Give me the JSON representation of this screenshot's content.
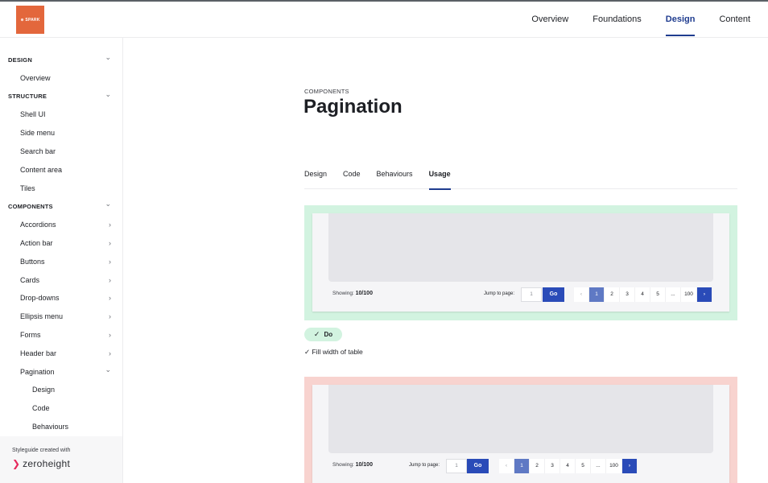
{
  "brand": {
    "logo_text": "⊕ SPARK",
    "logo_color": "#e3673c"
  },
  "topnav": [
    {
      "label": "Overview",
      "active": false
    },
    {
      "label": "Foundations",
      "active": false
    },
    {
      "label": "Design",
      "active": true
    },
    {
      "label": "Content",
      "active": false
    }
  ],
  "sidebar": {
    "items": [
      {
        "label": "DESIGN",
        "level": "section",
        "chevron": "chevron-down"
      },
      {
        "label": "Overview",
        "level": "l1",
        "chevron": ""
      },
      {
        "label": "STRUCTURE",
        "level": "section",
        "chevron": "chevron-down"
      },
      {
        "label": "Shell UI",
        "level": "l1",
        "chevron": ""
      },
      {
        "label": "Side menu",
        "level": "l1",
        "chevron": ""
      },
      {
        "label": "Search bar",
        "level": "l1",
        "chevron": ""
      },
      {
        "label": "Content area",
        "level": "l1",
        "chevron": ""
      },
      {
        "label": "Tiles",
        "level": "l1",
        "chevron": ""
      },
      {
        "label": "COMPONENTS",
        "level": "section",
        "chevron": "chevron-down"
      },
      {
        "label": "Accordions",
        "level": "l1",
        "chevron": "chevron-right"
      },
      {
        "label": "Action bar",
        "level": "l1",
        "chevron": "chevron-right"
      },
      {
        "label": "Buttons",
        "level": "l1",
        "chevron": "chevron-right"
      },
      {
        "label": "Cards",
        "level": "l1",
        "chevron": "chevron-right"
      },
      {
        "label": "Drop-downs",
        "level": "l1",
        "chevron": "chevron-right"
      },
      {
        "label": "Ellipsis menu",
        "level": "l1",
        "chevron": "chevron-right"
      },
      {
        "label": "Forms",
        "level": "l1",
        "chevron": "chevron-right"
      },
      {
        "label": "Header bar",
        "level": "l1",
        "chevron": "chevron-right"
      },
      {
        "label": "Pagination",
        "level": "l1",
        "chevron": "chevron-down"
      },
      {
        "label": "Design",
        "level": "l2",
        "chevron": ""
      },
      {
        "label": "Code",
        "level": "l2",
        "chevron": ""
      },
      {
        "label": "Behaviours",
        "level": "l2",
        "chevron": ""
      }
    ],
    "footer": {
      "made_with": "Styleguide created with",
      "brand": "zeroheight"
    }
  },
  "main": {
    "eyebrow": "COMPONENTS",
    "title": "Pagination",
    "tabs": [
      {
        "label": "Design",
        "active": false
      },
      {
        "label": "Code",
        "active": false
      },
      {
        "label": "Behaviours",
        "active": false
      },
      {
        "label": "Usage",
        "active": true
      }
    ],
    "examples": [
      {
        "kind": "do",
        "showing_label": "Showing:",
        "showing_value": "10/100",
        "jump_label": "Jump to page:",
        "input_value": "1",
        "go_label": "Go",
        "pages": [
          "‹",
          "1",
          "2",
          "3",
          "4",
          "5",
          "...",
          "100",
          "›"
        ],
        "current_page": "1"
      },
      {
        "kind": "dont",
        "showing_label": "Showing:",
        "showing_value": "10/100",
        "jump_label": "Jump to page:",
        "input_value": "1",
        "go_label": "Go",
        "pages": [
          "‹",
          "1",
          "2",
          "3",
          "4",
          "5",
          "...",
          "100",
          "›"
        ],
        "current_page": "1"
      }
    ],
    "badge": {
      "icon": "✓",
      "label": "Do"
    },
    "guidance": "✓ Fill width of table"
  },
  "colors": {
    "accent": "#1f3c8f",
    "button": "#2a4bb8",
    "do_bg": "#d2f3e0",
    "dont_bg": "#f8d3cf"
  }
}
